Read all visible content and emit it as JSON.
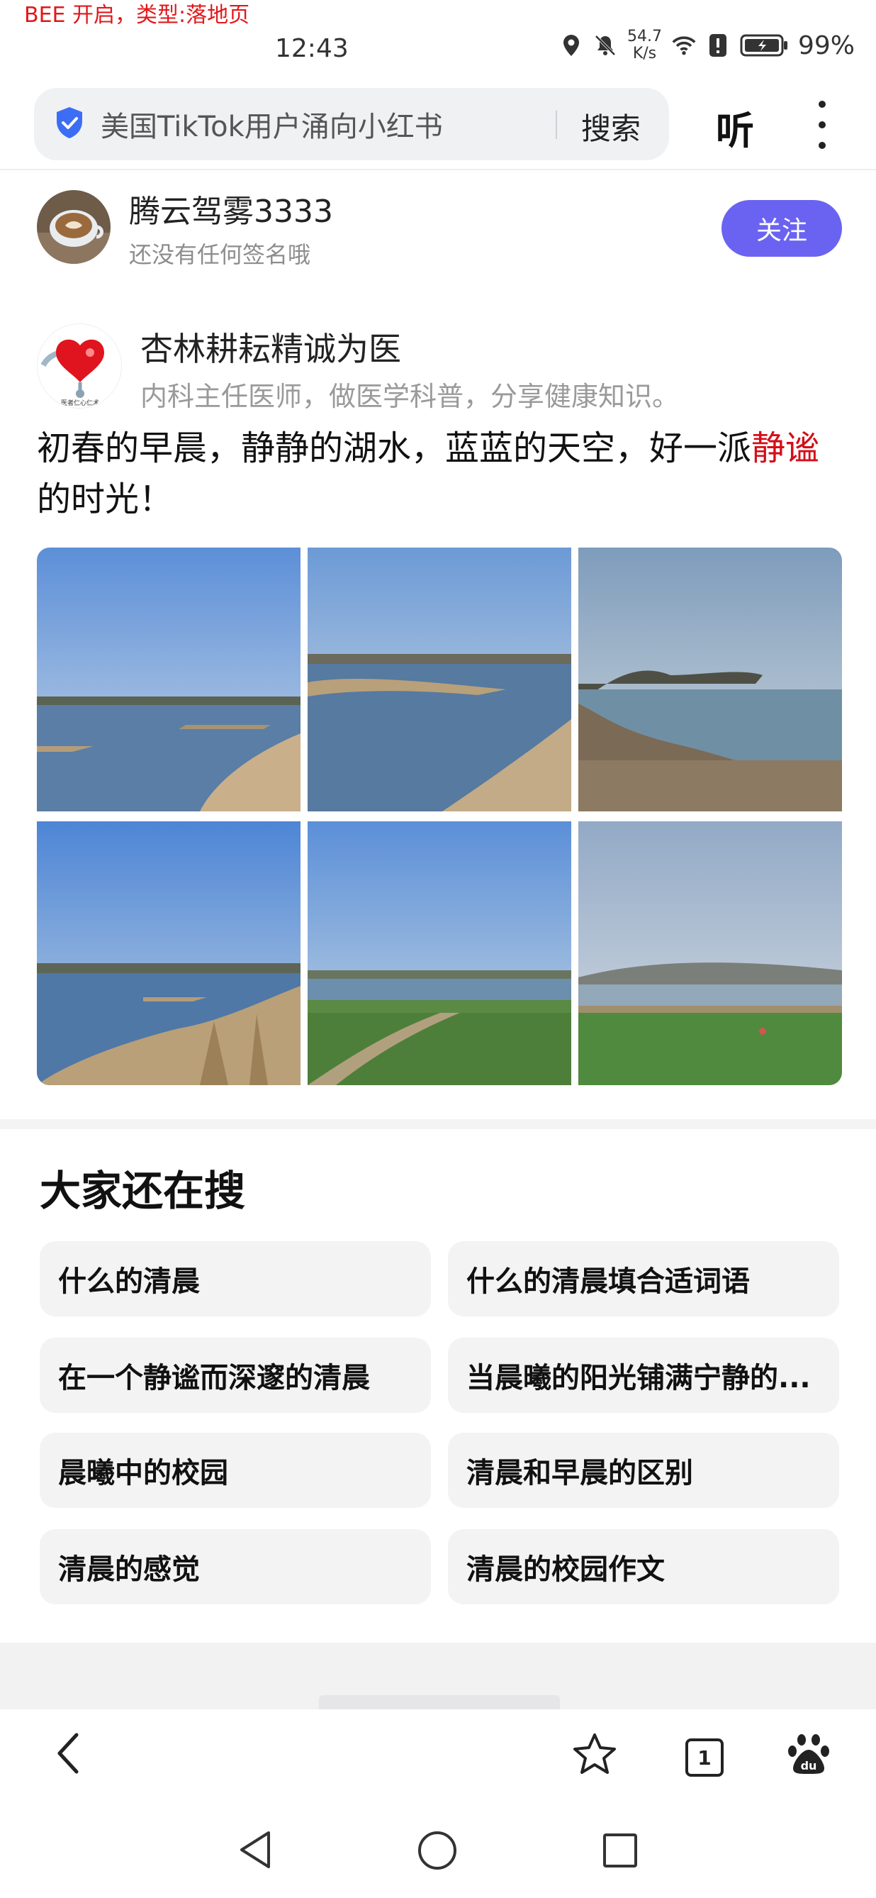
{
  "debug": {
    "tag": "BEE 开启，类型:落地页"
  },
  "status_bar": {
    "time": "12:43",
    "speed_value": "54.7",
    "speed_unit": "K/s",
    "battery": "99%",
    "icons": [
      "location-icon",
      "mute-bell-icon",
      "wifi-icon",
      "alert-icon",
      "battery-icon"
    ]
  },
  "search": {
    "query": "美国TikTok用户涌向小红书",
    "search_label": "搜索",
    "listen_label": "听"
  },
  "author": {
    "name": "腾云驾雾3333",
    "signature": "还没有任何签名哦",
    "follow_label": "关注"
  },
  "original_author": {
    "name": "杏林耕耘精诚为医",
    "description": "内科主任医师，做医学科普，分享健康知识。",
    "avatar_caption": "医者仁心仁术"
  },
  "post": {
    "text_before": "初春的早晨，静静的湖水，蓝蓝的天空，好一派",
    "highlight": "静谧",
    "text_after": "的时光！"
  },
  "related": {
    "title": "大家还在搜",
    "items": [
      "什么的清晨",
      "什么的清晨填合适词语",
      "在一个静谧而深邃的清晨",
      "当晨曦的阳光铺满宁静的...",
      "晨曦中的校园",
      "清晨和早晨的区别",
      "清晨的感觉",
      "清晨的校园作文"
    ]
  },
  "toolbar": {
    "tab_count": "1"
  },
  "colors": {
    "accent": "#6a63f1",
    "highlight": "#d40e18",
    "debug": "#e0181b"
  }
}
